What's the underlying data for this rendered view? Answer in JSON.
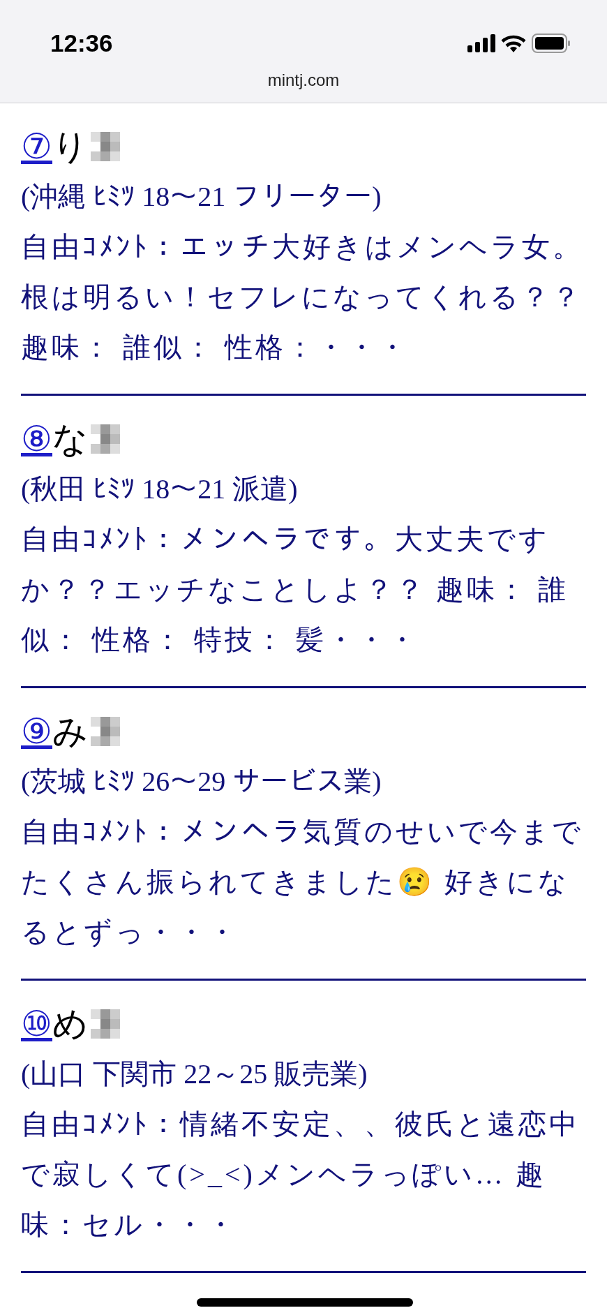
{
  "status_bar": {
    "time": "12:36",
    "url": "mintj.com"
  },
  "entries": [
    {
      "number": "⑦",
      "name": "り",
      "profile": "(沖縄 ﾋﾐﾂ 18～21 フリーター)",
      "comment": "自由ｺﾒﾝﾄ：エッチ大好きはメンヘラ女。根は明るい！セフレになってくれる？？趣味： 誰似： 性格：・・・"
    },
    {
      "number": "⑧",
      "name": "な",
      "profile": "(秋田 ﾋﾐﾂ 18～21 派遣)",
      "comment": "自由ｺﾒﾝﾄ：メンヘラです。大丈夫ですか？？エッチなことしよ？？ 趣味： 誰似： 性格： 特技： 髪・・・"
    },
    {
      "number": "⑨",
      "name": "み",
      "profile": "(茨城 ﾋﾐﾂ 26～29 サービス業)",
      "comment": "自由ｺﾒﾝﾄ：メンヘラ気質のせいで今までたくさん振られてきました😢 好きになるとずっ・・・"
    },
    {
      "number": "⑩",
      "name": "め",
      "profile": "(山口 下関市 22～25 販売業)",
      "comment": "自由ｺﾒﾝﾄ：情緒不安定、、彼氏と遠恋中で寂しくて(>_<)メンヘラっぽい… 趣味：セル・・・"
    }
  ]
}
